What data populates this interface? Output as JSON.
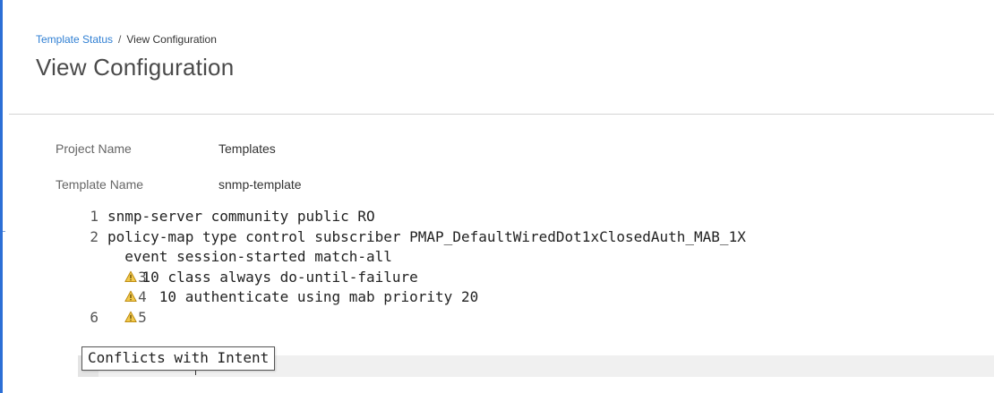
{
  "breadcrumb": {
    "link_label": "Template Status",
    "separator": "/",
    "current_label": "View Configuration"
  },
  "page": {
    "title": "View Configuration"
  },
  "fields": {
    "project_name_label": "Project Name",
    "project_name_value": "Templates",
    "template_name_label": "Template Name",
    "template_name_value": "snmp-template"
  },
  "code": {
    "lines": [
      {
        "number": "1",
        "text": "snmp-server community public RO",
        "warning": false
      },
      {
        "number": "2",
        "text": "policy-map type control subscriber PMAP_DefaultWiredDot1xClosedAuth_MAB_1X",
        "warning": false
      },
      {
        "number": "3",
        "text": "  event session-started match-all",
        "warning": true
      },
      {
        "number": "4",
        "text": "    10 class always do-until-failure",
        "warning": true
      },
      {
        "number": "5",
        "text": "      10 authenticate using mab priority 20",
        "warning": true
      },
      {
        "number": "6",
        "text": "",
        "warning": false
      }
    ],
    "partial_line_7": "     ",
    "warning_icon": "warning-triangle-icon"
  },
  "tooltip": {
    "text": "Conflicts with Intent"
  },
  "colors": {
    "accent": "#2c6fd6",
    "link": "#2f7fd3",
    "warning_fill": "#f2c94c",
    "warning_stroke": "#b8860b"
  }
}
